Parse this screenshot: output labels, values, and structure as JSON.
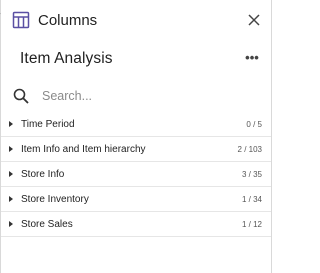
{
  "panel": {
    "title": "Columns",
    "close_icon": "close-icon",
    "table_icon": "table-columns-icon",
    "accent_color": "#5a4fa3"
  },
  "dataset": {
    "name": "Item Analysis",
    "more_icon": "more-horizontal-icon"
  },
  "search": {
    "placeholder": "Search...",
    "value": ""
  },
  "groups": [
    {
      "label": "Time Period",
      "count": "0 / 5"
    },
    {
      "label": "Item Info and Item hierarchy",
      "count": "2 / 103"
    },
    {
      "label": "Store Info",
      "count": "3 / 35"
    },
    {
      "label": "Store Inventory",
      "count": "1 / 34"
    },
    {
      "label": "Store Sales",
      "count": "1 / 12"
    }
  ]
}
